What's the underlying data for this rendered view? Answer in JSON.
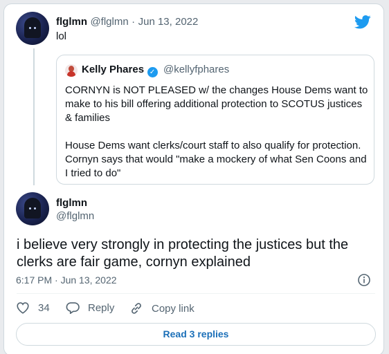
{
  "reply_tweet": {
    "display_name": "flglmn",
    "handle": "@flglmn",
    "separator": "·",
    "date": "Jun 13, 2022",
    "text": "lol"
  },
  "quoted_tweet": {
    "display_name": "Kelly Phares",
    "handle": "@kellyfphares",
    "text": "CORNYN is NOT PLEASED w/ the changes House Dems want to make to his bill offering additional protection to SCOTUS justices & families\n\nHouse Dems want clerks/court staff to also qualify for protection. Cornyn says that would \"make a mockery of what Sen Coons and I tried to do\""
  },
  "main_tweet": {
    "display_name": "flglmn",
    "handle": "@flglmn",
    "text": "i believe very strongly in protecting the justices but the clerks are fair game, cornyn explained",
    "timestamp": "6:17 PM · Jun 13, 2022"
  },
  "actions": {
    "like_count": "34",
    "reply_label": "Reply",
    "copy_link_label": "Copy link"
  },
  "read_replies_label": "Read 3 replies",
  "colors": {
    "brand_blue": "#1d9bf0",
    "link_blue": "#1b6fb8",
    "muted": "#536471"
  }
}
